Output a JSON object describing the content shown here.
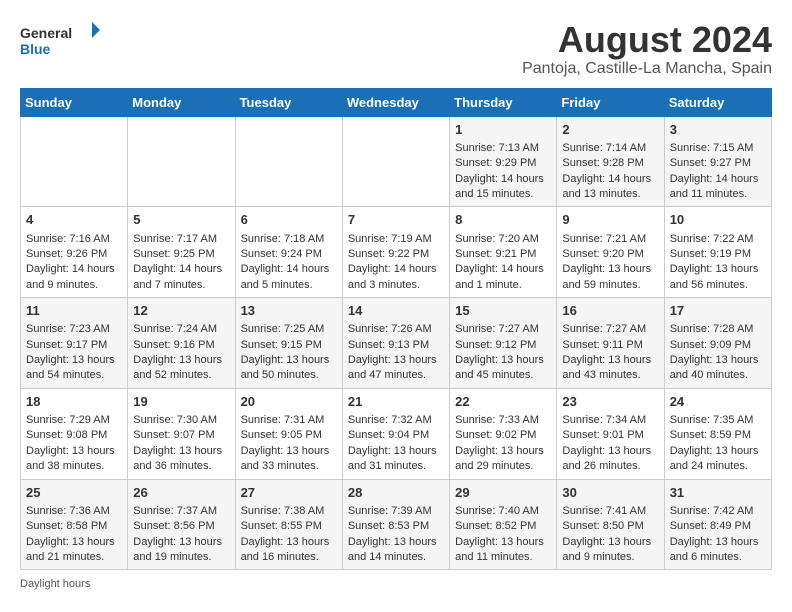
{
  "header": {
    "logo_line1": "General",
    "logo_line2": "Blue",
    "title": "August 2024",
    "subtitle": "Pantoja, Castille-La Mancha, Spain"
  },
  "weekdays": [
    "Sunday",
    "Monday",
    "Tuesday",
    "Wednesday",
    "Thursday",
    "Friday",
    "Saturday"
  ],
  "weeks": [
    [
      {
        "day": "",
        "text": ""
      },
      {
        "day": "",
        "text": ""
      },
      {
        "day": "",
        "text": ""
      },
      {
        "day": "",
        "text": ""
      },
      {
        "day": "1",
        "text": "Sunrise: 7:13 AM\nSunset: 9:29 PM\nDaylight: 14 hours and 15 minutes."
      },
      {
        "day": "2",
        "text": "Sunrise: 7:14 AM\nSunset: 9:28 PM\nDaylight: 14 hours and 13 minutes."
      },
      {
        "day": "3",
        "text": "Sunrise: 7:15 AM\nSunset: 9:27 PM\nDaylight: 14 hours and 11 minutes."
      }
    ],
    [
      {
        "day": "4",
        "text": "Sunrise: 7:16 AM\nSunset: 9:26 PM\nDaylight: 14 hours and 9 minutes."
      },
      {
        "day": "5",
        "text": "Sunrise: 7:17 AM\nSunset: 9:25 PM\nDaylight: 14 hours and 7 minutes."
      },
      {
        "day": "6",
        "text": "Sunrise: 7:18 AM\nSunset: 9:24 PM\nDaylight: 14 hours and 5 minutes."
      },
      {
        "day": "7",
        "text": "Sunrise: 7:19 AM\nSunset: 9:22 PM\nDaylight: 14 hours and 3 minutes."
      },
      {
        "day": "8",
        "text": "Sunrise: 7:20 AM\nSunset: 9:21 PM\nDaylight: 14 hours and 1 minute."
      },
      {
        "day": "9",
        "text": "Sunrise: 7:21 AM\nSunset: 9:20 PM\nDaylight: 13 hours and 59 minutes."
      },
      {
        "day": "10",
        "text": "Sunrise: 7:22 AM\nSunset: 9:19 PM\nDaylight: 13 hours and 56 minutes."
      }
    ],
    [
      {
        "day": "11",
        "text": "Sunrise: 7:23 AM\nSunset: 9:17 PM\nDaylight: 13 hours and 54 minutes."
      },
      {
        "day": "12",
        "text": "Sunrise: 7:24 AM\nSunset: 9:16 PM\nDaylight: 13 hours and 52 minutes."
      },
      {
        "day": "13",
        "text": "Sunrise: 7:25 AM\nSunset: 9:15 PM\nDaylight: 13 hours and 50 minutes."
      },
      {
        "day": "14",
        "text": "Sunrise: 7:26 AM\nSunset: 9:13 PM\nDaylight: 13 hours and 47 minutes."
      },
      {
        "day": "15",
        "text": "Sunrise: 7:27 AM\nSunset: 9:12 PM\nDaylight: 13 hours and 45 minutes."
      },
      {
        "day": "16",
        "text": "Sunrise: 7:27 AM\nSunset: 9:11 PM\nDaylight: 13 hours and 43 minutes."
      },
      {
        "day": "17",
        "text": "Sunrise: 7:28 AM\nSunset: 9:09 PM\nDaylight: 13 hours and 40 minutes."
      }
    ],
    [
      {
        "day": "18",
        "text": "Sunrise: 7:29 AM\nSunset: 9:08 PM\nDaylight: 13 hours and 38 minutes."
      },
      {
        "day": "19",
        "text": "Sunrise: 7:30 AM\nSunset: 9:07 PM\nDaylight: 13 hours and 36 minutes."
      },
      {
        "day": "20",
        "text": "Sunrise: 7:31 AM\nSunset: 9:05 PM\nDaylight: 13 hours and 33 minutes."
      },
      {
        "day": "21",
        "text": "Sunrise: 7:32 AM\nSunset: 9:04 PM\nDaylight: 13 hours and 31 minutes."
      },
      {
        "day": "22",
        "text": "Sunrise: 7:33 AM\nSunset: 9:02 PM\nDaylight: 13 hours and 29 minutes."
      },
      {
        "day": "23",
        "text": "Sunrise: 7:34 AM\nSunset: 9:01 PM\nDaylight: 13 hours and 26 minutes."
      },
      {
        "day": "24",
        "text": "Sunrise: 7:35 AM\nSunset: 8:59 PM\nDaylight: 13 hours and 24 minutes."
      }
    ],
    [
      {
        "day": "25",
        "text": "Sunrise: 7:36 AM\nSunset: 8:58 PM\nDaylight: 13 hours and 21 minutes."
      },
      {
        "day": "26",
        "text": "Sunrise: 7:37 AM\nSunset: 8:56 PM\nDaylight: 13 hours and 19 minutes."
      },
      {
        "day": "27",
        "text": "Sunrise: 7:38 AM\nSunset: 8:55 PM\nDaylight: 13 hours and 16 minutes."
      },
      {
        "day": "28",
        "text": "Sunrise: 7:39 AM\nSunset: 8:53 PM\nDaylight: 13 hours and 14 minutes."
      },
      {
        "day": "29",
        "text": "Sunrise: 7:40 AM\nSunset: 8:52 PM\nDaylight: 13 hours and 11 minutes."
      },
      {
        "day": "30",
        "text": "Sunrise: 7:41 AM\nSunset: 8:50 PM\nDaylight: 13 hours and 9 minutes."
      },
      {
        "day": "31",
        "text": "Sunrise: 7:42 AM\nSunset: 8:49 PM\nDaylight: 13 hours and 6 minutes."
      }
    ]
  ],
  "footer": "Daylight hours"
}
